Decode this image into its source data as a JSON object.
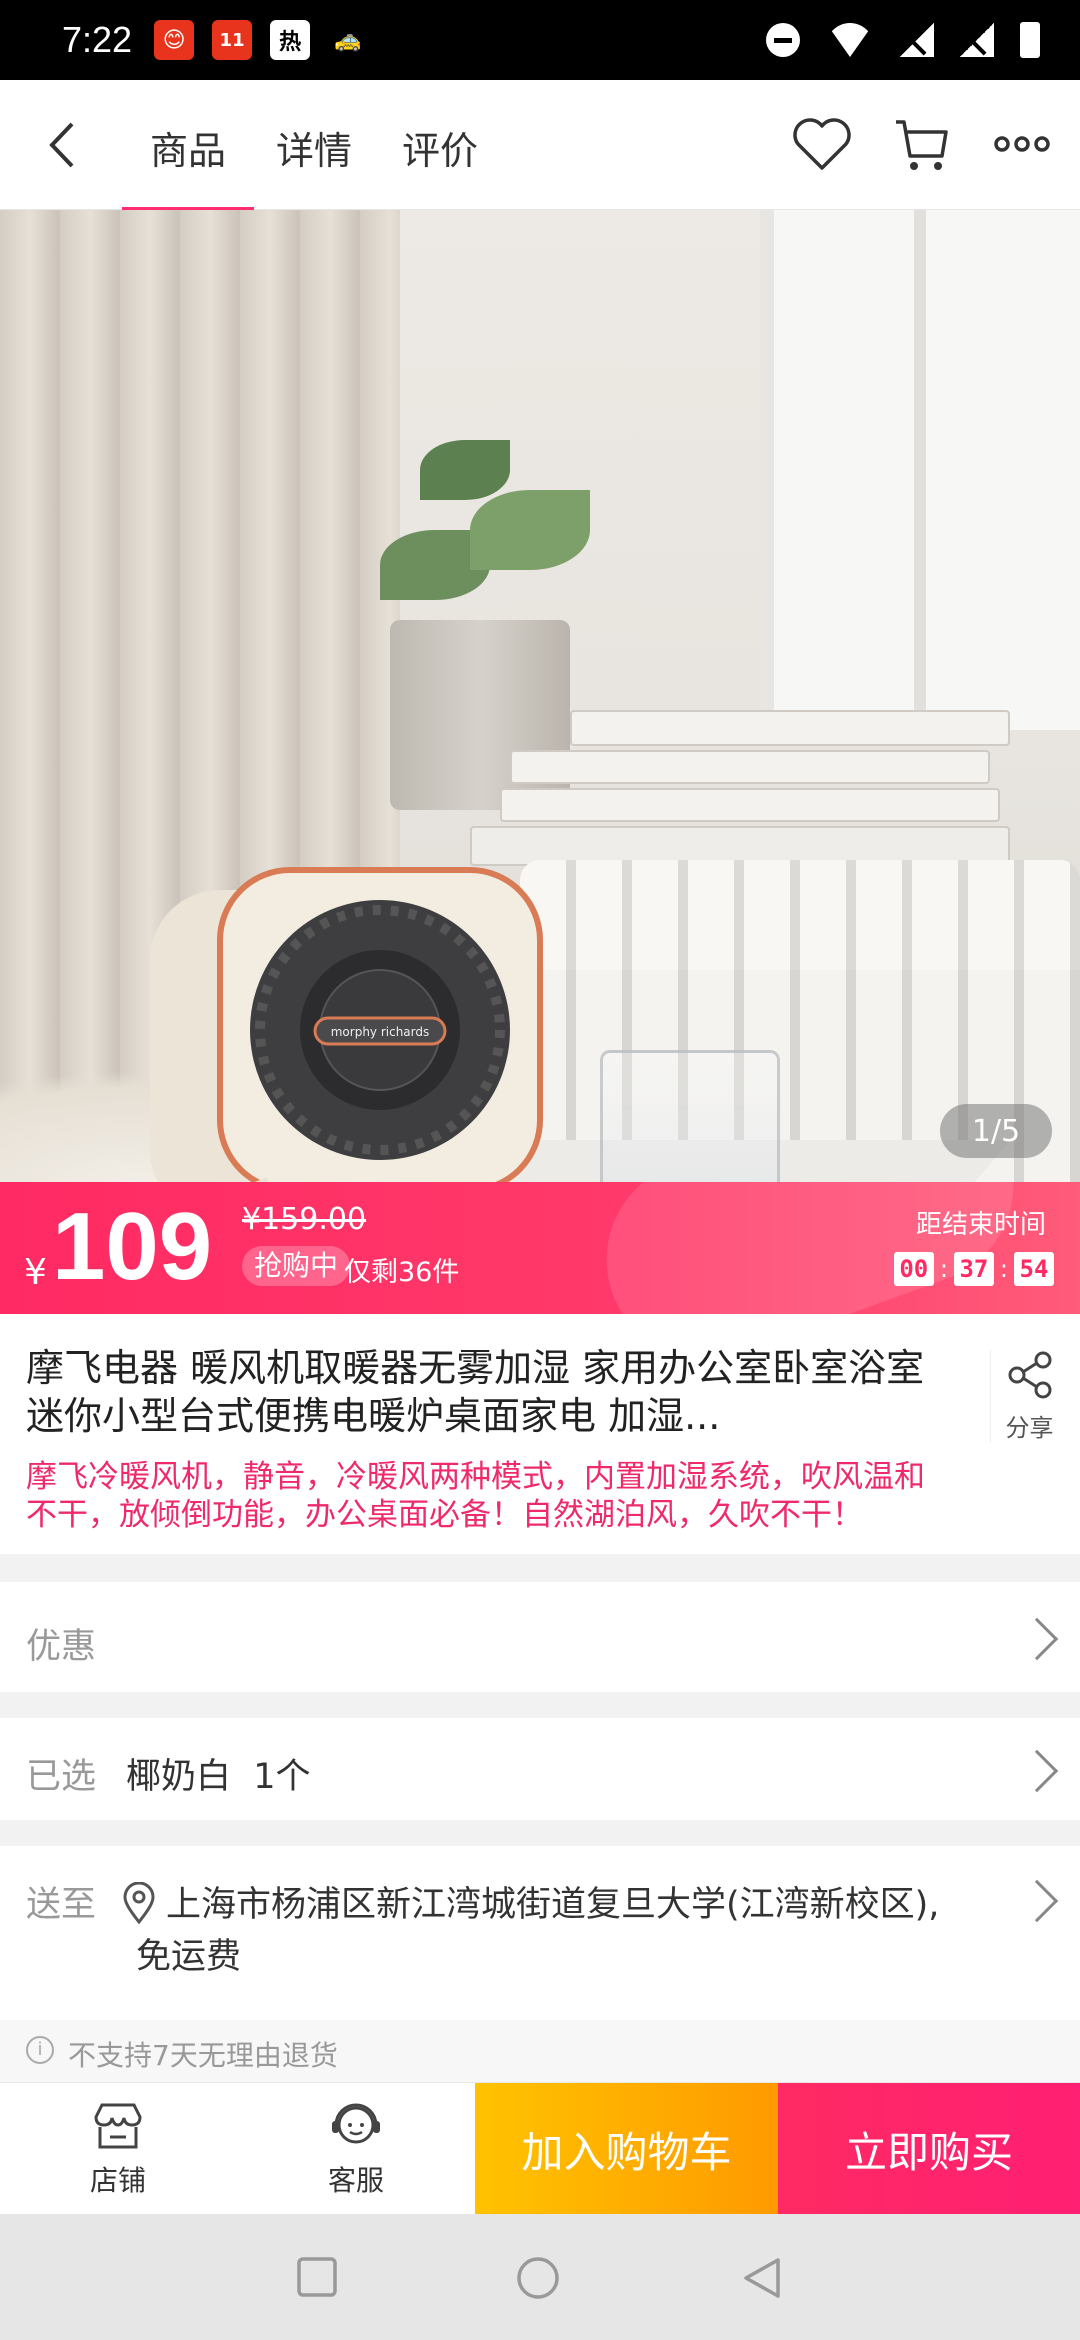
{
  "status_bar": {
    "time": "7:22",
    "notifications": [
      {
        "icon": "weibo-like-app-icon",
        "color": "#e8341c",
        "text": "😊"
      },
      {
        "icon": "shopping-1111-icon",
        "color": "#e8341c",
        "text": "11"
      },
      {
        "icon": "hot-icon",
        "color": "#111111",
        "text": "热"
      },
      {
        "icon": "taxi-icon",
        "color": "#f5c400",
        "text": "🚕"
      }
    ]
  },
  "nav": {
    "tabs": [
      {
        "label": "商品",
        "active": true
      },
      {
        "label": "详情",
        "active": false
      },
      {
        "label": "评价",
        "active": false
      }
    ]
  },
  "gallery": {
    "counter": "1/5",
    "heater_logo": "morphy richards"
  },
  "price": {
    "currency": "¥",
    "current": "109",
    "original": "¥159.00",
    "badge": "抢购中",
    "stock": "仅剩36件",
    "countdown_label": "距结束时间",
    "countdown": {
      "h": "00",
      "m": "37",
      "s": "54"
    }
  },
  "product": {
    "title": "摩飞电器 暖风机取暖器无雾加湿 家用办公室卧室浴室迷你小型台式便携电暖炉桌面家电 加湿...",
    "description": "摩飞冷暖风机，静音，冷暖风两种模式，内置加湿系统，吹风温和不干，放倾倒功能，办公桌面必备！自然湖泊风，久吹不干！",
    "share_label": "分享"
  },
  "rows": {
    "discount_label": "优惠",
    "selected_label": "已选",
    "selected_value": "椰奶白  1个",
    "ship_label": "送至",
    "ship_address": "上海市杨浦区新江湾城街道复旦大学(江湾新校区),",
    "ship_fee": "免运费"
  },
  "return_policy": "不支持7天无理由退货",
  "bottom_bar": {
    "store_label": "店铺",
    "service_label": "客服",
    "add_cart_label": "加入购物车",
    "buy_now_label": "立即购买"
  },
  "colors": {
    "accent": "#ff2a63",
    "cart_button": "#ffb000",
    "description_text": "#ee2a6a"
  }
}
